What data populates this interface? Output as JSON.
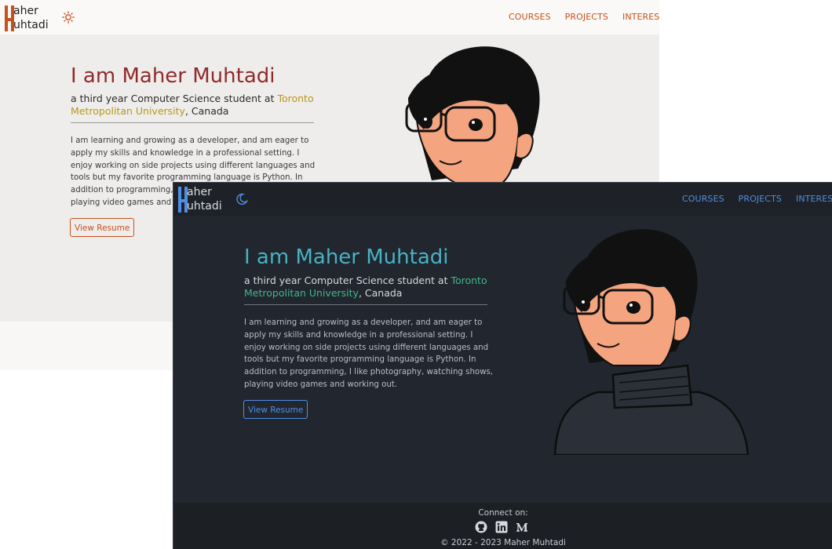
{
  "brand": {
    "first_name": "aher",
    "last_name": "uhtadi",
    "light_accent": "#c8501a",
    "dark_accent": "#4f8fe6"
  },
  "nav": {
    "items": [
      "COURSES",
      "PROJECTS",
      "INTERESTS"
    ]
  },
  "hero": {
    "title": "I am Maher Muhtadi",
    "subtitle_prefix": "a third year Computer Science student at ",
    "university": "Toronto Metropolitan University",
    "subtitle_suffix": ", Canada",
    "bio": "I am learning and growing as a developer, and am eager to apply my skills and knowledge in a professional setting. I enjoy working on side projects using different languages and tools but my favorite programming language is Python. In addition to programming, I like photography, watching shows, playing video games and working out.",
    "resume_label": "View Resume"
  },
  "footer": {
    "connect_label": "Connect on:",
    "social_icons": [
      "github-icon",
      "linkedin-icon",
      "medium-icon"
    ],
    "copyright": "© 2022 - 2023 Maher Muhtadi"
  },
  "theme": {
    "light_icon": "sun-icon",
    "dark_icon": "moon-icon"
  }
}
